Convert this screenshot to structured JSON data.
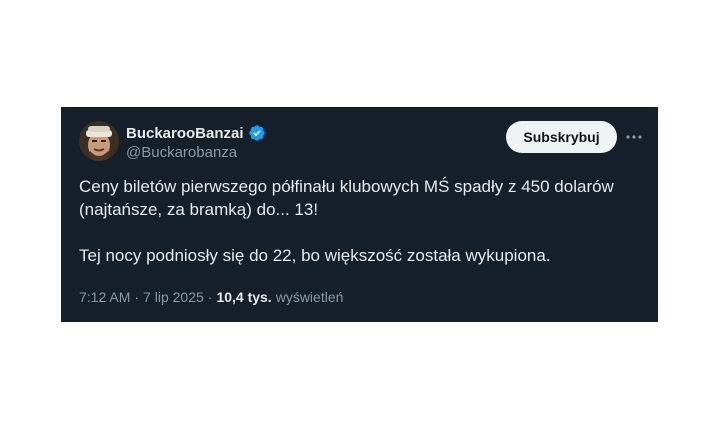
{
  "author": {
    "display_name": "BuckarooBanzai",
    "handle": "@Buckarobanza",
    "verified_icon": "verified-badge-icon",
    "verified_color": "#1d9bf0"
  },
  "actions": {
    "subscribe_label": "Subskrybuj",
    "more_icon": "more-horizontal-icon"
  },
  "tweet": {
    "paragraphs": [
      "Ceny biletów pierwszego półfinału klubowych MŚ spadły z 450 dolarów (najtańsze, za bramką) do... 13!",
      "Tej nocy podniosły się do 22, bo większość została wykupiona."
    ]
  },
  "meta": {
    "time": "7:12 AM",
    "separator": "·",
    "date": "7 lip 2025",
    "views_count": "10,4 tys.",
    "views_label": "wyświetleń"
  },
  "colors": {
    "background": "#15202b",
    "text_primary": "#e7e9ea",
    "text_secondary": "#8b98a5",
    "button_bg": "#eff3f4"
  }
}
